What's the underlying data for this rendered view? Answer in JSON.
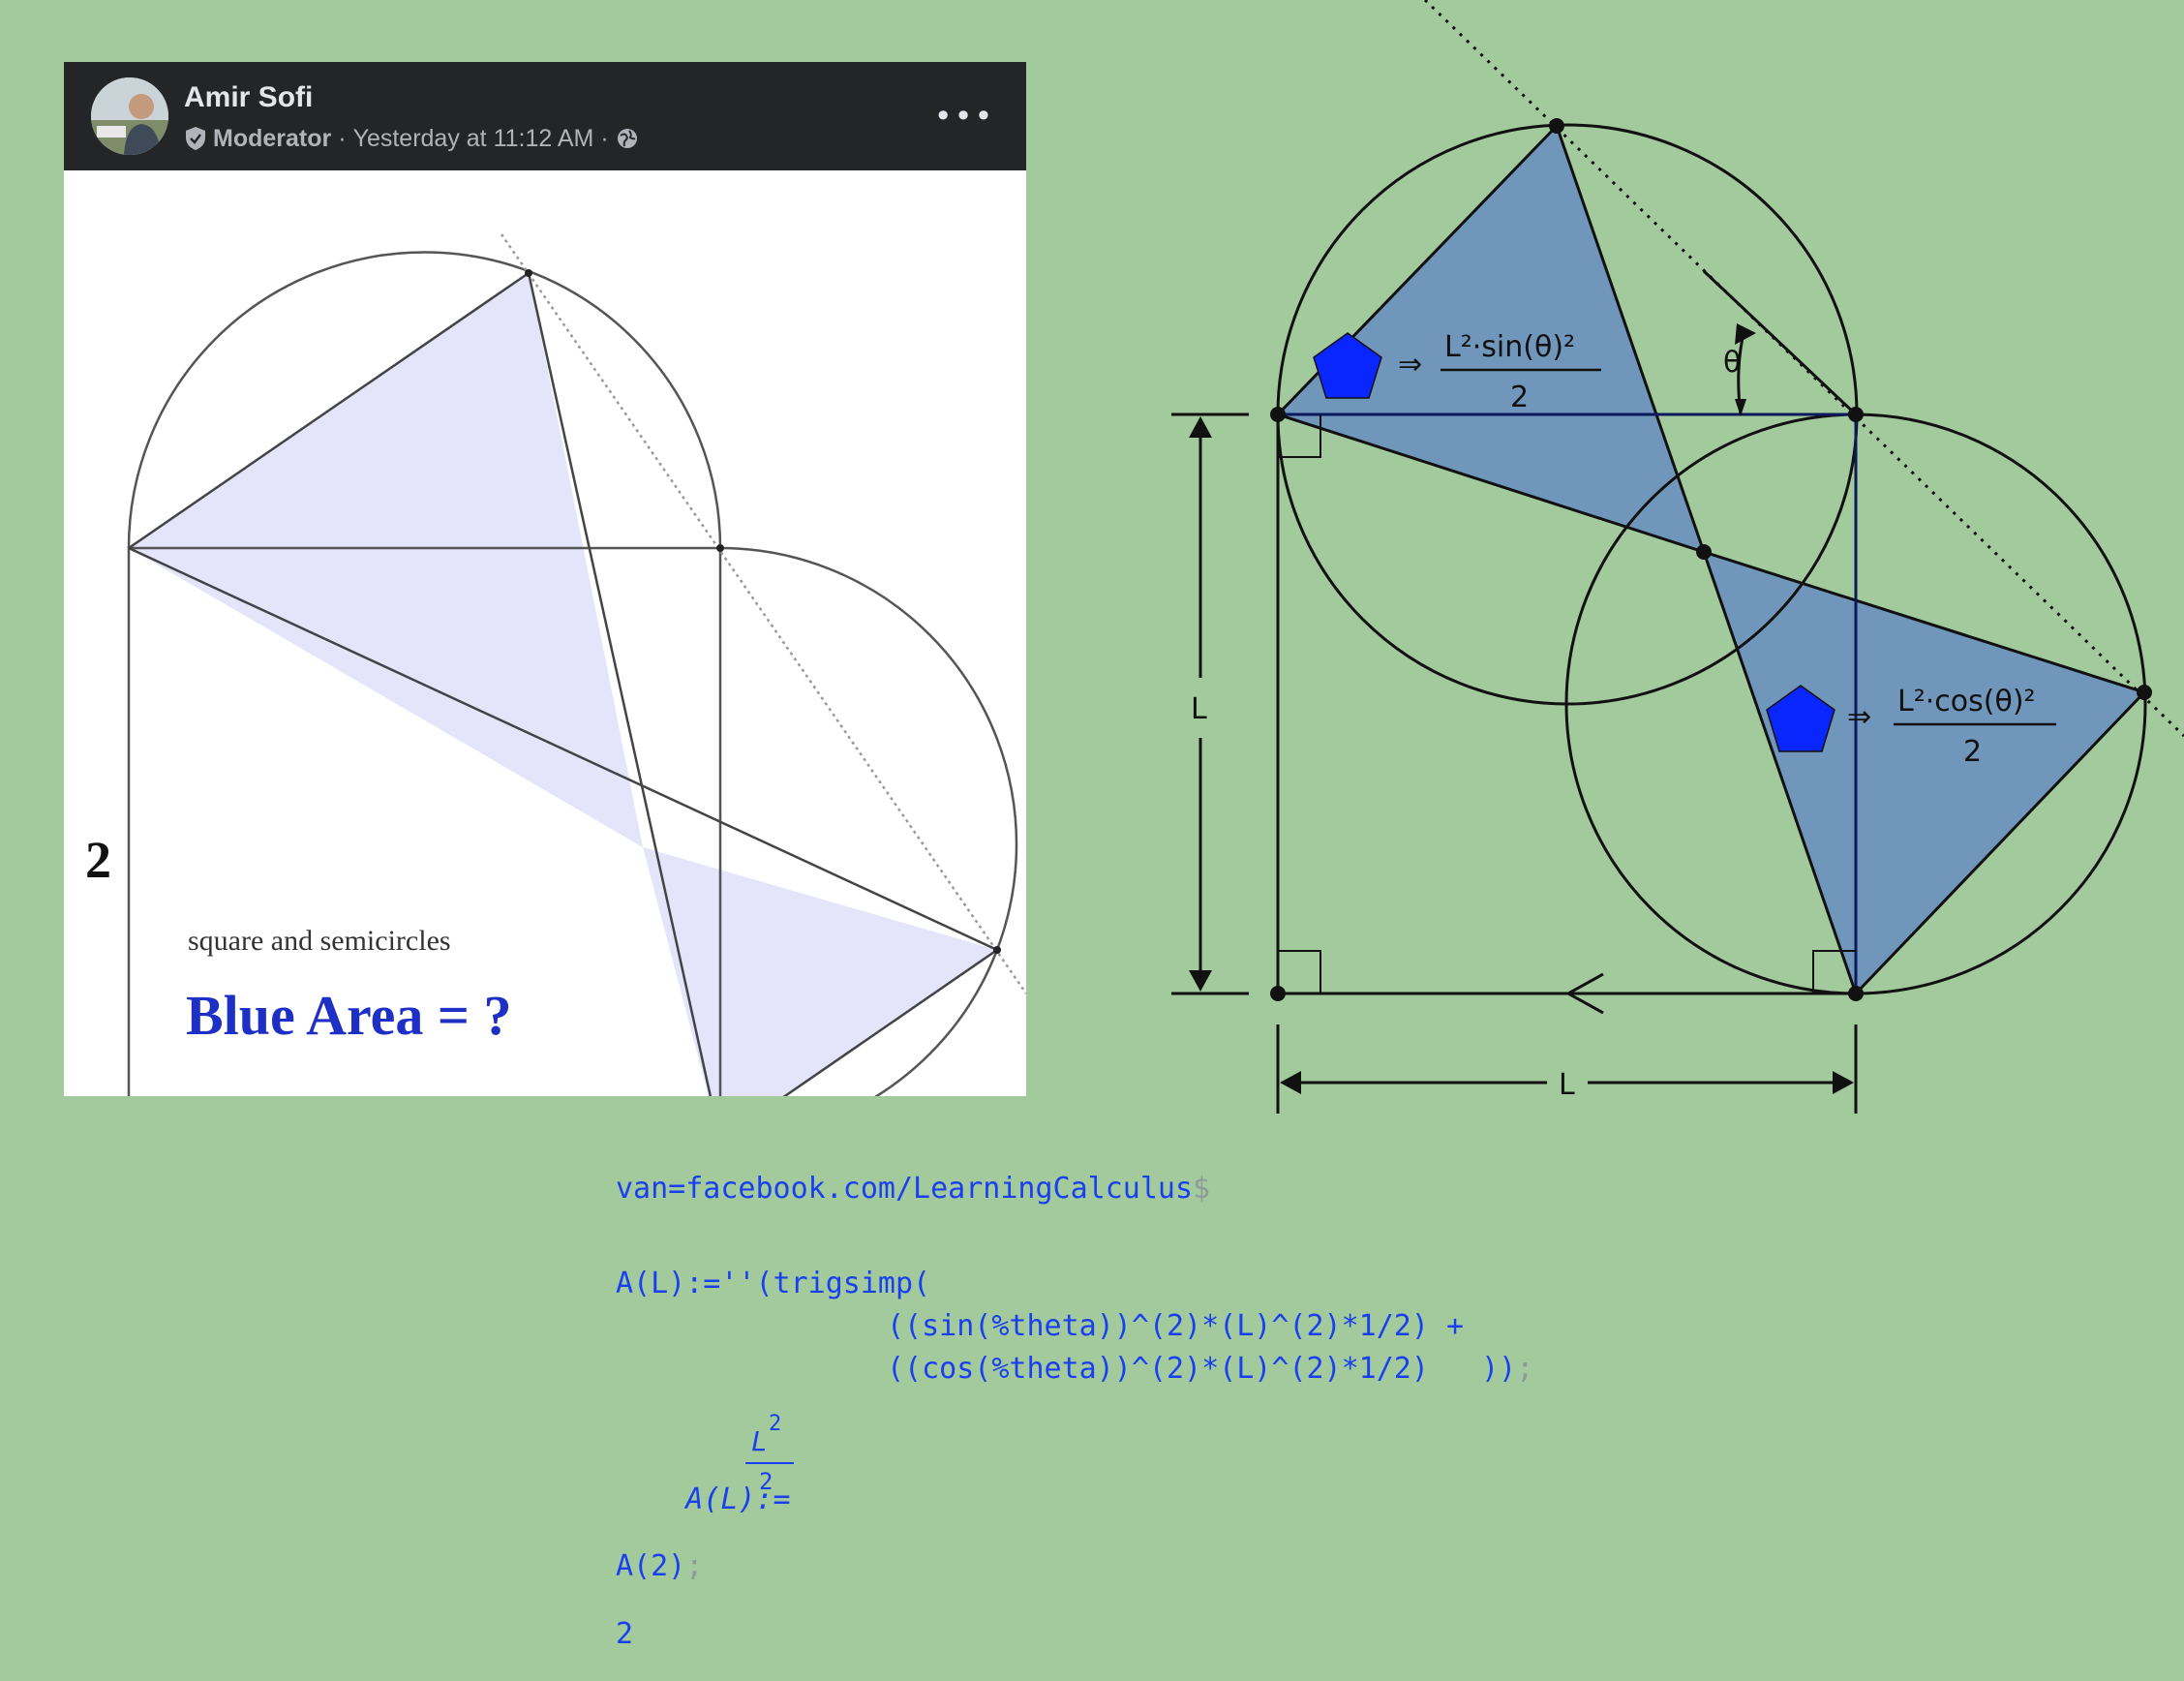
{
  "post": {
    "author": "Amir Sofi",
    "role": "Moderator",
    "separator": "·",
    "timestamp": "Yesterday at 11:12 AM",
    "visibility_icon": "globe-icon",
    "shield_icon": "shield-icon",
    "more_icon": "more-icon",
    "more_label": "•••",
    "figure": {
      "side_label": "2",
      "caption": "square and semicircles",
      "question": "Blue Area = ?"
    }
  },
  "diagram": {
    "top_fraction": {
      "numerator": "L²·sin(θ)²",
      "denominator": "2"
    },
    "bottom_fraction": {
      "numerator": "L²·cos(θ)²",
      "denominator": "2"
    },
    "implies": "⇒",
    "angle_label": "θ",
    "vertical_dimension": "L",
    "horizontal_dimension": "L",
    "colors": {
      "triangle_fill": "#7097bb",
      "pentagon_fill": "#0a26ff",
      "background": "#a2ca9c"
    }
  },
  "code": {
    "line1": "van=facebook.com/LearningCalculus",
    "line1_suffix": "$",
    "line2": "A(L):=''(trigsimp(",
    "line3": "((sin(%theta))^(2)*(L)^(2)*1/2) +",
    "line4": "((cos(%theta))^(2)*(L)^(2)*1/2)   ))",
    "line4_suffix": ";",
    "result_lhs": "A(L):=",
    "result_num": "L",
    "result_exp": "2",
    "result_den": "2",
    "call": "A(2)",
    "call_suffix": ";",
    "output": "2"
  }
}
